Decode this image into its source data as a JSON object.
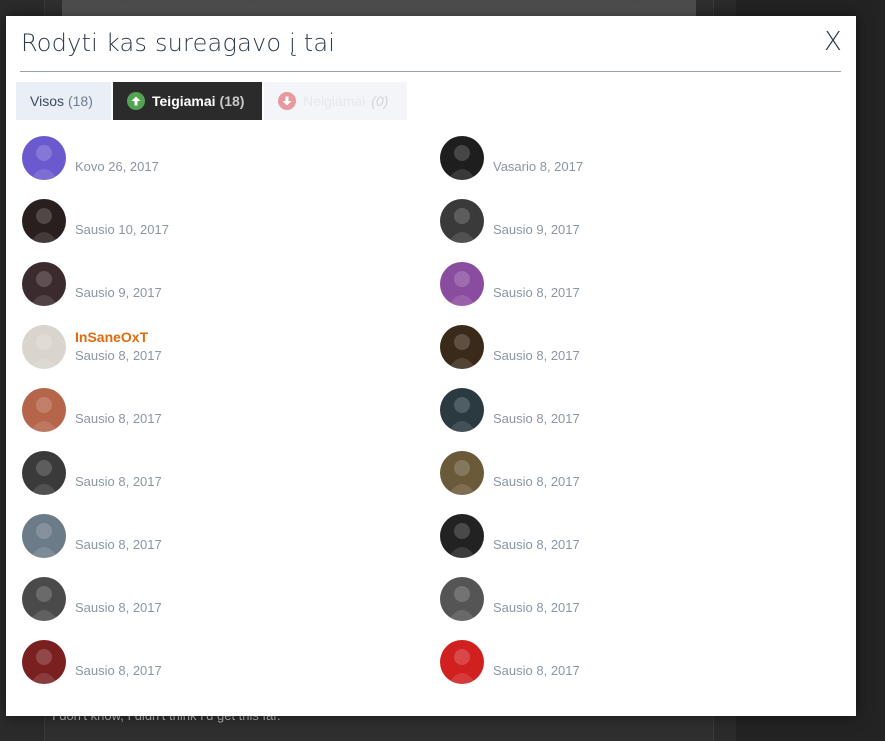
{
  "modal": {
    "title": "Rodyti kas sureagavo į tai",
    "close_label": "X",
    "tabs": [
      {
        "label": "Visos",
        "count": "(18)"
      },
      {
        "label": "Teigiamai",
        "count": "(18)"
      },
      {
        "label": "Neigiamai",
        "count": "(0)"
      }
    ],
    "left_entries": [
      {
        "name": "",
        "date": "Kovo 26, 2017",
        "avatar_color": "#6a5acd"
      },
      {
        "name": "",
        "date": "Sausio 10, 2017",
        "avatar_color": "#2a1f1f"
      },
      {
        "name": "",
        "date": "Sausio 9, 2017",
        "avatar_color": "#3b2a2e"
      },
      {
        "name": "InSaneOxT",
        "date": "Sausio 8, 2017",
        "avatar_color": "#d9d4cc"
      },
      {
        "name": "",
        "date": "Sausio 8, 2017",
        "avatar_color": "#b5654a"
      },
      {
        "name": "",
        "date": "Sausio 8, 2017",
        "avatar_color": "#3a3a3a"
      },
      {
        "name": "",
        "date": "Sausio 8, 2017",
        "avatar_color": "#6b7b88"
      },
      {
        "name": "",
        "date": "Sausio 8, 2017",
        "avatar_color": "#4a4a4a"
      },
      {
        "name": "",
        "date": "Sausio 8, 2017",
        "avatar_color": "#7a2020"
      }
    ],
    "right_entries": [
      {
        "name": "",
        "date": "Vasario 8, 2017",
        "avatar_color": "#1e1e1e"
      },
      {
        "name": "",
        "date": "Sausio 9, 2017",
        "avatar_color": "#3a3a3a"
      },
      {
        "name": "",
        "date": "Sausio 8, 2017",
        "avatar_color": "#8a4c9e"
      },
      {
        "name": "",
        "date": "Sausio 8, 2017",
        "avatar_color": "#3a2a1a"
      },
      {
        "name": "",
        "date": "Sausio 8, 2017",
        "avatar_color": "#2a3a40"
      },
      {
        "name": "",
        "date": "Sausio 8, 2017",
        "avatar_color": "#6b5a3a"
      },
      {
        "name": "",
        "date": "Sausio 8, 2017",
        "avatar_color": "#222222"
      },
      {
        "name": "",
        "date": "Sausio 8, 2017",
        "avatar_color": "#555555"
      },
      {
        "name": "",
        "date": "Sausio 8, 2017",
        "avatar_color": "#d02020"
      }
    ]
  },
  "background": {
    "text": "I don't know, I didn't think I'd get this far."
  },
  "colors": {
    "accent_username": "#e06b0c",
    "positive": "#53a354",
    "negative": "#e59a9f"
  }
}
